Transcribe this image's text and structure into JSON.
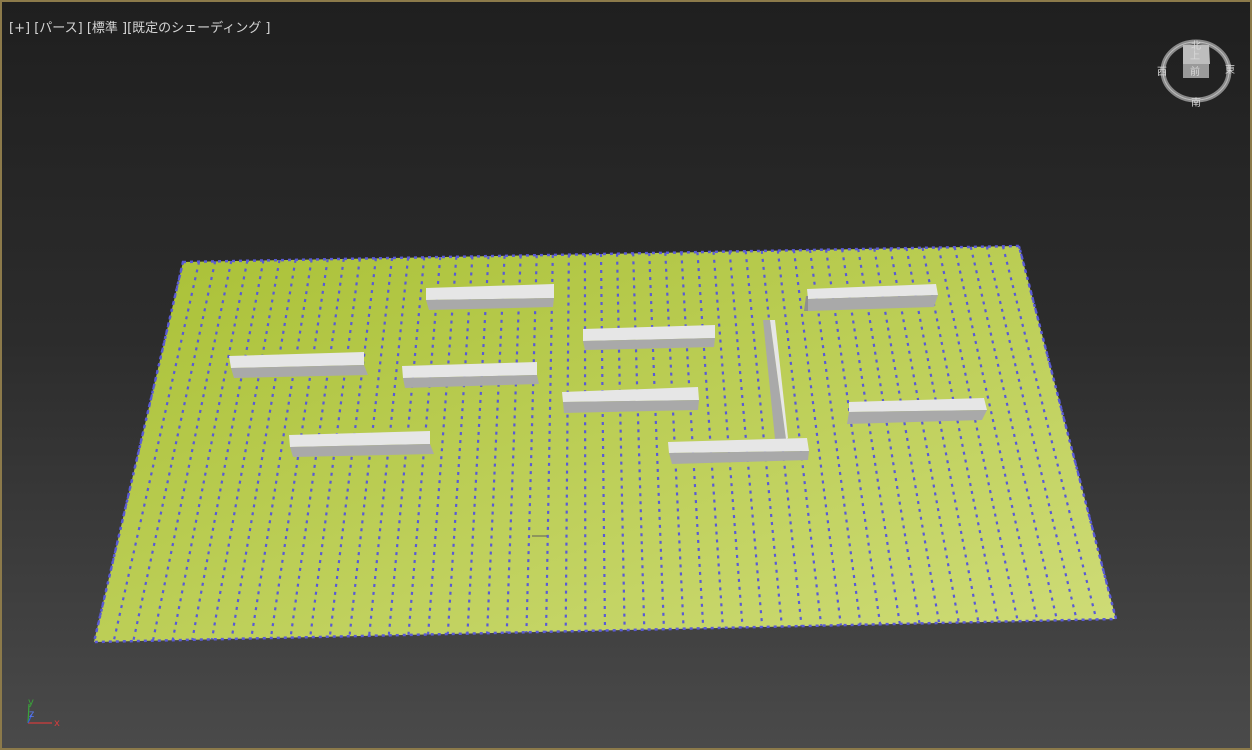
{
  "viewport": {
    "label_parts": [
      "[+]",
      "[パース]",
      "[標準 ]",
      "[既定のシェーディング ]"
    ]
  },
  "viewcube": {
    "top_face": "上",
    "front_face": "前",
    "compass": {
      "north": "北",
      "south": "南",
      "east": "東",
      "west": "西"
    }
  },
  "axis_tripod": {
    "x_label": "x",
    "y_label": "y",
    "z_label": "z"
  },
  "colors": {
    "ground_plane": "#b8cc4a",
    "grid_dots": "#5a5ad6",
    "wall_top": "#e6e6e6",
    "wall_side": "#a9a9a9",
    "border": "#8c7a4a"
  },
  "scene": {
    "plane_grid_columns": 52,
    "plane_grid_rows": 48,
    "wall_count": 11
  }
}
